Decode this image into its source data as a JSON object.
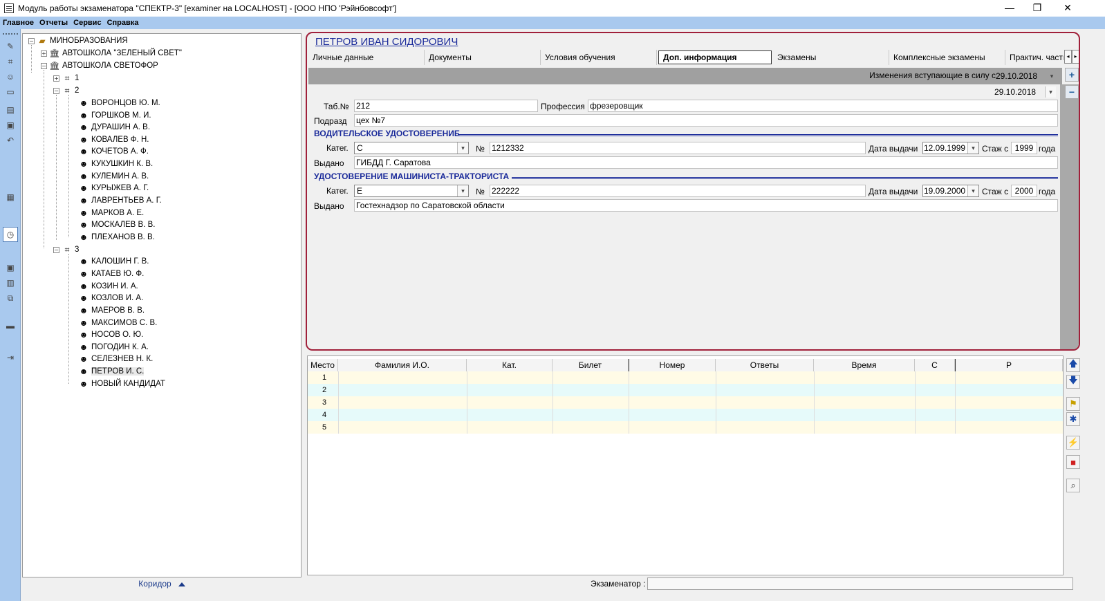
{
  "window": {
    "title": "Модуль работы экзаменатора \"СПЕКТР-3\" [examiner на LOCALHOST] - [ООО НПО 'Рэйнбовсофт']",
    "minimize": "—",
    "restore": "❐",
    "close": "✕"
  },
  "menu": [
    "Главное",
    "Отчеты",
    "Сервис",
    "Справка"
  ],
  "tree": {
    "root": "МИНОБРАЗОВАНИЯ",
    "school1": "АВТОШКОЛА \"ЗЕЛЕНЫЙ СВЕТ\"",
    "school2": "АВТОШКОЛА СВЕТОФОР",
    "group1": "1",
    "group2": "2",
    "group3": "3",
    "group2_members": [
      "ВОРОНЦОВ Ю. М.",
      "ГОРШКОВ М. И.",
      "ДУРАШИН А. В.",
      "КОВАЛЕВ Ф. Н.",
      "КОЧЕТОВ А. Ф.",
      "КУКУШКИН К. В.",
      "КУЛЕМИН А. В.",
      "КУРЫЖЕВ А. Г.",
      "ЛАВРЕНТЬЕВ А. Г.",
      "МАРКОВ А. Е.",
      "МОСКАЛЕВ В. В.",
      "ПЛЕХАНОВ В. В."
    ],
    "group3_members": [
      "КАЛОШИН Г. В.",
      "КАТАЕВ Ю. Ф.",
      "КОЗИН И. А.",
      "КОЗЛОВ И. А.",
      "МАЕРОВ В. В.",
      "МАКСИМОВ С. В.",
      "НОСОВ О. Ю.",
      "ПОГОДИН К. А.",
      "СЕЛЕЗНЕВ Н. К.",
      "ПЕТРОВ И. С.",
      "НОВЫЙ КАНДИДАТ"
    ],
    "selected": "ПЕТРОВ И. С."
  },
  "corridor_label": "Коридор",
  "person": {
    "name": "ПЕТРОВ ИВАН СИДОРОВИЧ"
  },
  "tabs": [
    "Личные данные",
    "Документы",
    "Условия обучения",
    "Доп. информация",
    "Экзамены",
    "Комплексные экзамены",
    "Практич. часть"
  ],
  "active_tab": "Доп. информация",
  "changes": {
    "label": "Изменения вступающие в силу с",
    "date": "29.10.2018",
    "date2": "29.10.2018"
  },
  "form": {
    "tab_label": "Таб.№",
    "tab_value": "212",
    "profession_label": "Профессия",
    "profession_value": "фрезеровщик",
    "dept_label": "Подразд",
    "dept_value": "цех №7",
    "driver_section": "ВОДИТЕЛЬСКОЕ УДОСТОВЕРЕНИЕ",
    "tractor_section": "УДОСТОВЕРЕНИЕ МАШИНИСТА-ТРАКТОРИСТА",
    "cat_label": "Катег.",
    "num_label": "№",
    "issue_date_label": "Дата выдачи",
    "exp_label": "Стаж с",
    "years_label": "года",
    "issued_label": "Выдано",
    "driver": {
      "category": "C",
      "number": "1212332",
      "issue_date": "12.09.1999",
      "exp_from": "1999",
      "issued_by": "ГИБДД Г. Саратова"
    },
    "tractor": {
      "category": "E",
      "number": "222222",
      "issue_date": "19.09.2000",
      "exp_from": "2000",
      "issued_by": "Гостехнадзор по Саратовской области"
    }
  },
  "grid": {
    "columns": [
      "Место",
      "Фамилия И.О.",
      "Кат.",
      "Билет",
      "Номер",
      "Ответы",
      "Время",
      "С",
      "Р"
    ],
    "rows": [
      "1",
      "2",
      "3",
      "4",
      "5"
    ]
  },
  "examiner_label": "Экзаменатор :",
  "colors": {
    "menu_bg": "#a9c9ee",
    "panel_border": "#a0203a",
    "section_text": "#1a2a9a",
    "row_yellow": "#fffbe6",
    "row_cyan": "#e6fafa"
  }
}
